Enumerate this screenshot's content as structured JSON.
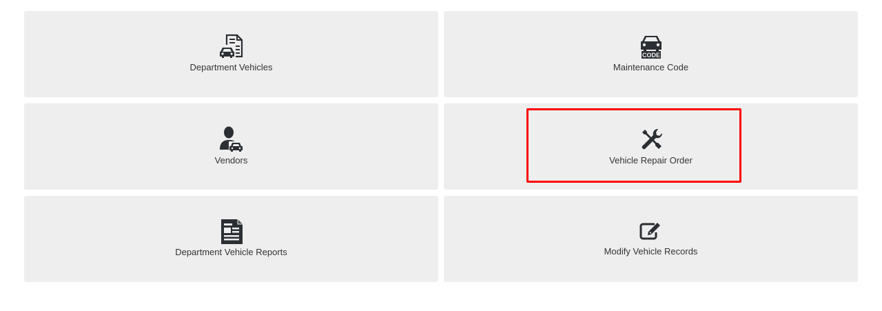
{
  "tiles": [
    {
      "label": "Department Vehicles",
      "icon": "vehicle-document-icon"
    },
    {
      "label": "Maintenance Code",
      "icon": "car-code-icon"
    },
    {
      "label": "Vendors",
      "icon": "user-car-icon"
    },
    {
      "label": "Vehicle Repair Order",
      "icon": "wrench-screwdriver-icon"
    },
    {
      "label": "Department Vehicle Reports",
      "icon": "newspaper-icon"
    },
    {
      "label": "Modify Vehicle Records",
      "icon": "edit-icon"
    }
  ],
  "icon_color": "#2b2f33",
  "tile_background": "#eeeeee",
  "highlight_color": "#ff0000"
}
